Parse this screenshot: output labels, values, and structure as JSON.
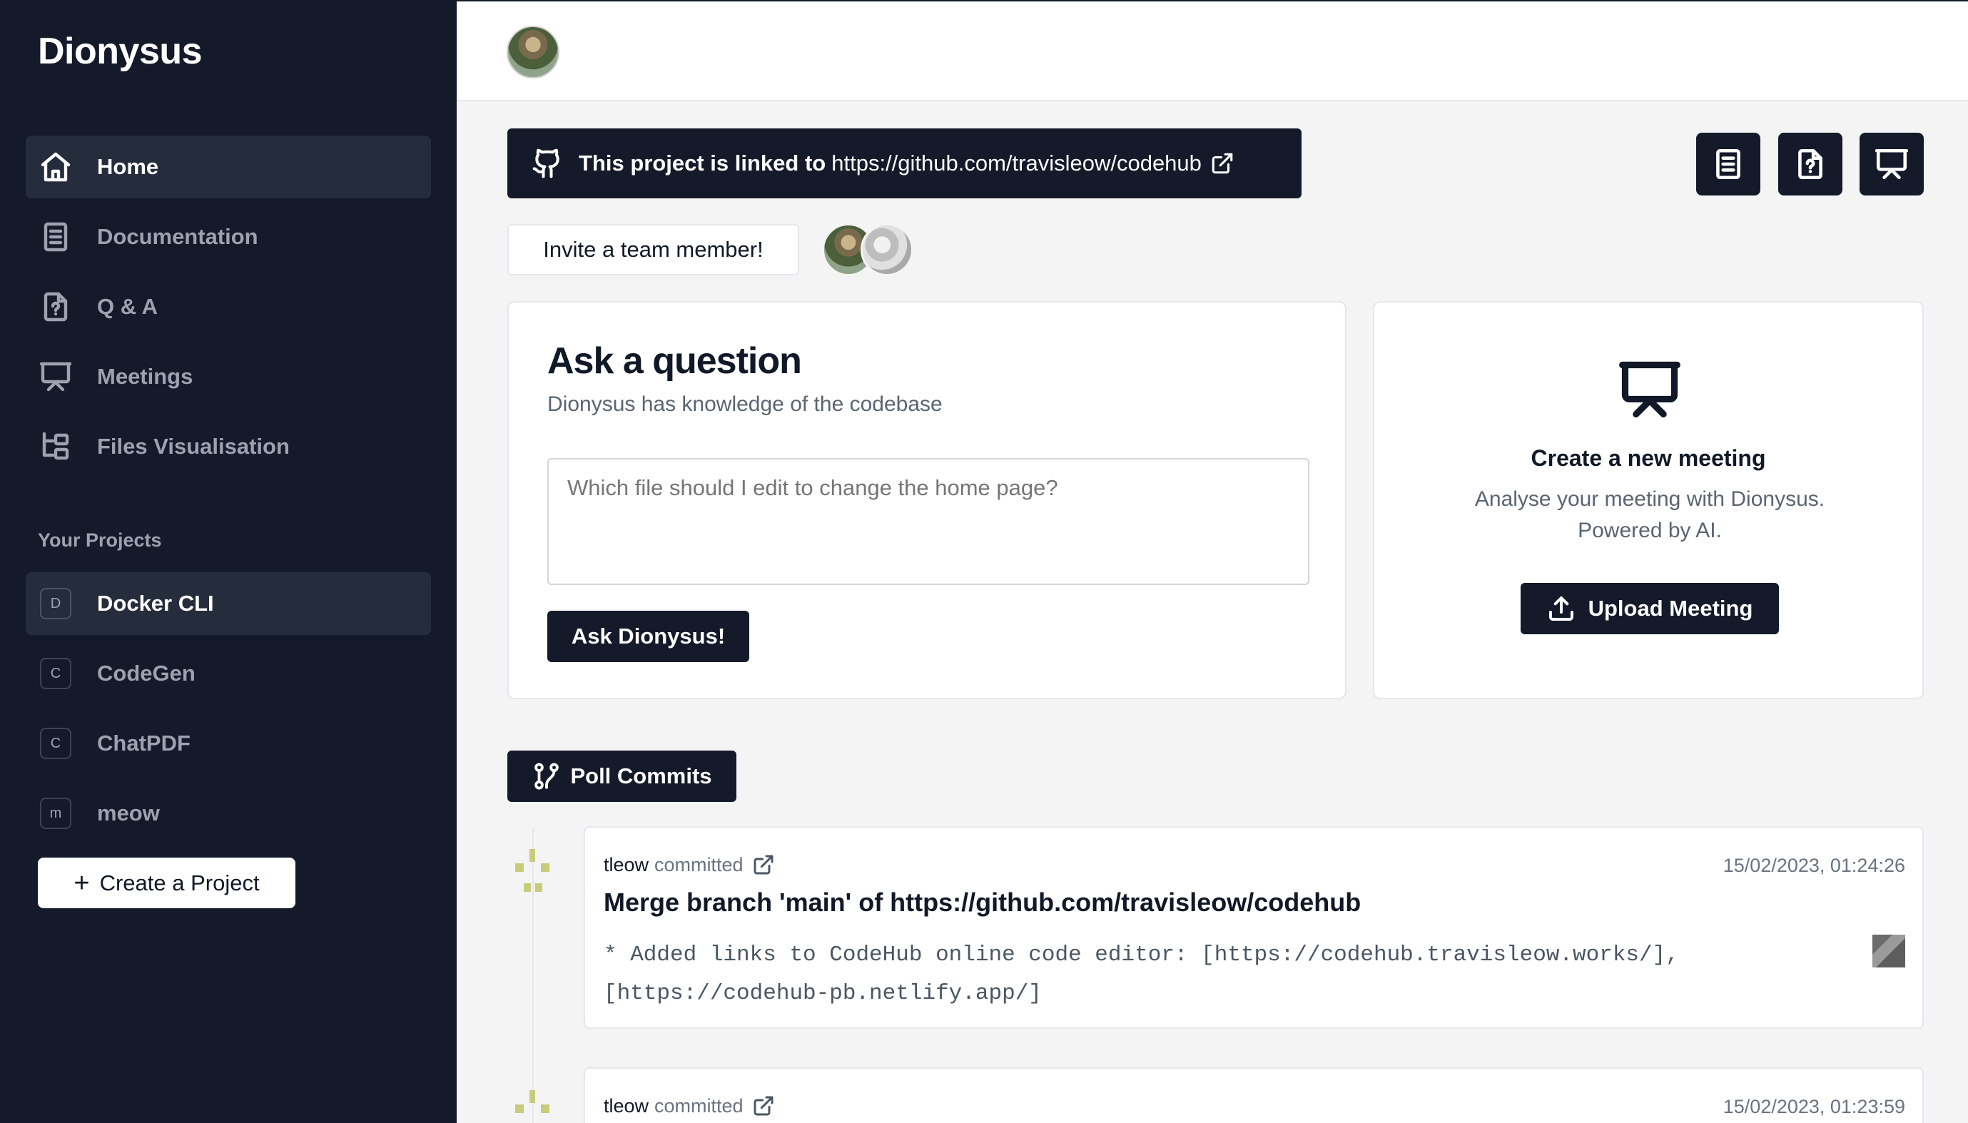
{
  "app": {
    "name": "Dionysus"
  },
  "sidebar": {
    "nav": [
      {
        "label": "Home",
        "icon": "home-icon",
        "active": true
      },
      {
        "label": "Documentation",
        "icon": "book-icon",
        "active": false
      },
      {
        "label": "Q & A",
        "icon": "file-question-icon",
        "active": false
      },
      {
        "label": "Meetings",
        "icon": "presentation-icon",
        "active": false
      },
      {
        "label": "Files Visualisation",
        "icon": "folder-tree-icon",
        "active": false
      }
    ],
    "projects_label": "Your Projects",
    "projects": [
      {
        "badge": "D",
        "label": "Docker CLI",
        "active": true
      },
      {
        "badge": "C",
        "label": "CodeGen",
        "active": false
      },
      {
        "badge": "C",
        "label": "ChatPDF",
        "active": false
      },
      {
        "badge": "m",
        "label": "meow",
        "active": false
      }
    ],
    "create_label": "Create a Project"
  },
  "banner": {
    "prefix": "This project is linked to",
    "url": "https://github.com/travisleow/codehub"
  },
  "toolbar_icons": [
    "book-icon",
    "file-question-icon",
    "presentation-icon"
  ],
  "invite_label": "Invite a team member!",
  "ask": {
    "title": "Ask a question",
    "subtitle": "Dionysus has knowledge of the codebase",
    "placeholder": "Which file should I edit to change the home page?",
    "button": "Ask Dionysus!"
  },
  "meeting": {
    "title": "Create a new meeting",
    "subtitle": "Analyse your meeting with Dionysus. Powered by AI.",
    "button": "Upload Meeting"
  },
  "poll_label": "Poll Commits",
  "commits": [
    {
      "author": "tleow",
      "verb": "committed",
      "time": "15/02/2023, 01:24:26",
      "title": "Merge branch 'main' of https://github.com/travisleow/codehub",
      "body": "* Added links to CodeHub online code editor: [https://codehub.travisleow.works/], [https://codehub-pb.netlify.app/]"
    },
    {
      "author": "tleow",
      "verb": "committed",
      "time": "15/02/2023, 01:23:59"
    }
  ],
  "colors": {
    "sidebar_bg": "#141a2a",
    "active_item_bg": "#252c3b",
    "primary_button": "#141a2a",
    "page_bg": "#f4f4f4"
  }
}
